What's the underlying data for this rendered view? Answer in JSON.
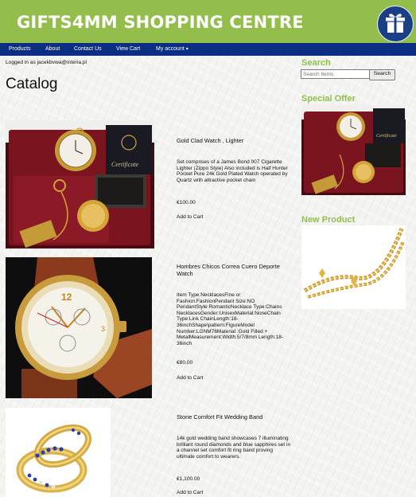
{
  "header": {
    "site_title": "GIFTS4MM SHOPPING CENTRE",
    "logo_icon": "gift-box-icon",
    "background": "#93be4c",
    "logo_color": "#1b3f86"
  },
  "nav": {
    "background": "#0b2d82",
    "items": [
      {
        "label": "Products"
      },
      {
        "label": "About"
      },
      {
        "label": "Contact Us"
      },
      {
        "label": "View Cart"
      },
      {
        "label": "My account",
        "has_dropdown": true
      }
    ]
  },
  "user": {
    "logged_in_text": "Logged in as jacekbvwa@interia.pl"
  },
  "catalog": {
    "title": "Catalog",
    "products": [
      {
        "name": "Gold Clad Watch , Lighter",
        "image": "pocket-watch-lighter-gift-set",
        "description": "Set comprises of a James Bond 007 Cigarette Lighter (Zippo Style) Also included is Half Hunter Pocket Pure 24k Gold Plated Watch operated by Quartz with attractive pocket chain",
        "price": "€100.00",
        "add_to_cart": "Add to Cart"
      },
      {
        "name": "Hombres Chicos Correa Cuero Deporte Watch",
        "image": "gold-chronograph-wristwatch",
        "description": "Item Type:NecklacesFine or Fashion:FashionPendant Size:NO PendantStyle:RomanticNecklace Type:Chains NecklacesGender:UnisexMaterial:NoneChain Type:Link ChainLength:18-36inchShape\\pattern:FigureModel Number:LGNM76Material :Gold Filled + MetalMeasurement:Width:5/7/8mm Length:18-36inch",
        "price": "€80.00",
        "add_to_cart": "Add to Cart"
      },
      {
        "name": "Stone Comfort Fit Wedding Band",
        "image": "gold-wedding-bands-sapphires",
        "description": "14k gold wedding band showcases 7 illuminating brilliant round diamonds and blue sapphires set in a channel set comfort fit ring band proving ultimate comfort to wearers.",
        "price": "€1,100.00",
        "add_to_cart": "Add to Cart"
      }
    ]
  },
  "sidebar": {
    "search": {
      "heading": "Search",
      "placeholder": "Search Items",
      "button_label": "Search"
    },
    "special_offer": {
      "heading": "Special Offer",
      "image": "pocket-watch-lighter-gift-set"
    },
    "new_product": {
      "heading": "New Product",
      "image": "gold-chain-necklace"
    },
    "heading_color": "#93be4c"
  }
}
